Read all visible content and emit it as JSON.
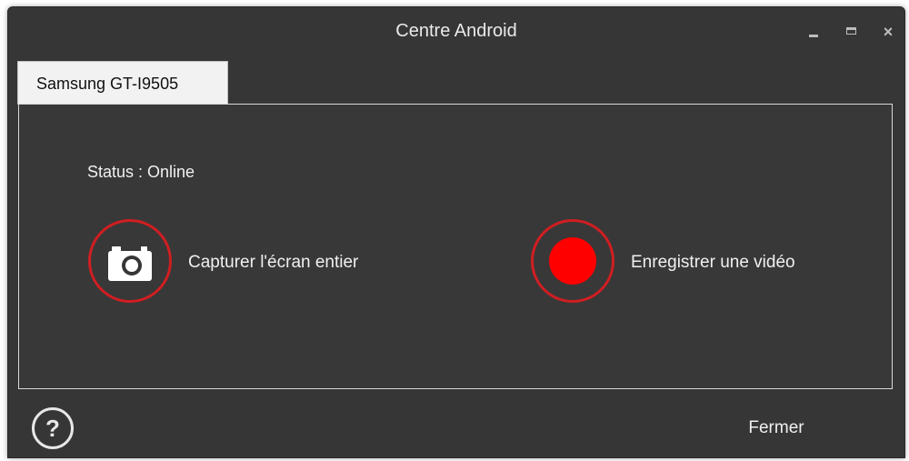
{
  "window": {
    "title": "Centre Android",
    "controls": {
      "minimize_icon": "minimize-icon",
      "maximize_icon": "maximize-icon",
      "close_label": "×"
    }
  },
  "tabs": [
    {
      "label": "Samsung GT-I9505",
      "selected": true
    }
  ],
  "device": {
    "status_text": "Status : Online"
  },
  "actions": {
    "screenshot": {
      "label": "Capturer l'écran entier",
      "icon": "camera-icon"
    },
    "record": {
      "label": "Enregistrer une vidéo",
      "icon": "record-icon"
    }
  },
  "footer": {
    "help_label": "?",
    "close_label": "Fermer"
  },
  "colors": {
    "window_bg": "#363636",
    "accent_red": "#d01e22",
    "record_fill": "#ff0000",
    "text": "#f0f0f0",
    "tab_bg": "#f2f2f2"
  }
}
